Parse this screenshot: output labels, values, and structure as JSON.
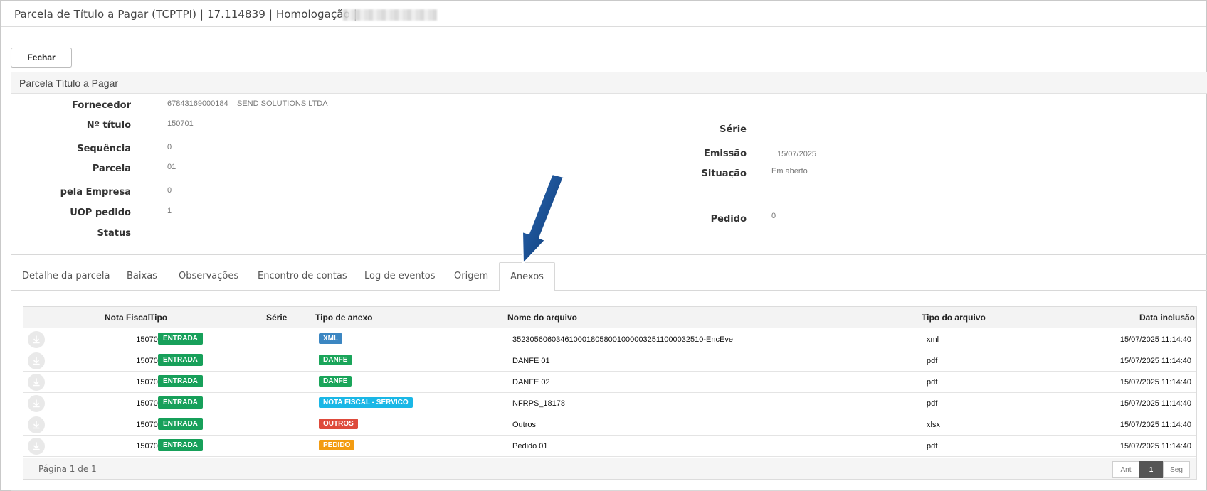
{
  "window": {
    "title": "Parcela de Título a Pagar (TCPTPI) | 17.114839 | Homologação |"
  },
  "toolbar": {
    "close_label": "Fechar"
  },
  "panel": {
    "title": "Parcela Título a Pagar",
    "fields": {
      "fornecedor_label": "Fornecedor",
      "fornecedor_code": "67843169000184",
      "fornecedor_name": "SEND SOLUTIONS LTDA",
      "titulo_label": "Nº título",
      "titulo_value": "150701",
      "sequencia_label": "Sequência",
      "sequencia_value": "0",
      "parcela_label": "Parcela",
      "parcela_value": "01",
      "empresa_label": "pela Empresa",
      "empresa_value": "0",
      "uop_label": "UOP pedido",
      "uop_value": "1",
      "status_label": "Status",
      "serie_label": "Série",
      "emissao_label": "Emissão",
      "emissao_value": "15/07/2025",
      "situacao_label": "Situação",
      "situacao_value": "Em aberto",
      "pedido_label": "Pedido",
      "pedido_value": "0"
    }
  },
  "tabs": [
    {
      "label": "Detalhe da parcela"
    },
    {
      "label": "Baixas"
    },
    {
      "label": "Observações"
    },
    {
      "label": "Encontro de contas"
    },
    {
      "label": "Log de eventos"
    },
    {
      "label": "Origem"
    },
    {
      "label": "Anexos",
      "active": true
    }
  ],
  "grid": {
    "columns": [
      "Nota Fiscal",
      "Tipo",
      "Série",
      "Tipo de anexo",
      "Nome do arquivo",
      "Tipo do arquivo",
      "Data inclusão"
    ],
    "rows": [
      {
        "nota": "150701",
        "tipo": "ENTRADA",
        "serie": "",
        "anexo": "XML",
        "anexo_color": "#3b86c2",
        "arquivo": "35230560603461000180580010000032511000032510-EncEve",
        "tipo_arquivo": "xml",
        "data": "15/07/2025 11:14:40"
      },
      {
        "nota": "150701",
        "tipo": "ENTRADA",
        "serie": "",
        "anexo": "DANFE",
        "anexo_color": "#1aa55a",
        "arquivo": "DANFE 01",
        "tipo_arquivo": "pdf",
        "data": "15/07/2025 11:14:40"
      },
      {
        "nota": "150701",
        "tipo": "ENTRADA",
        "serie": "",
        "anexo": "DANFE",
        "anexo_color": "#1aa55a",
        "arquivo": "DANFE 02",
        "tipo_arquivo": "pdf",
        "data": "15/07/2025 11:14:40"
      },
      {
        "nota": "150701",
        "tipo": "ENTRADA",
        "serie": "",
        "anexo": "NOTA FISCAL - SERVICO",
        "anexo_color": "#1ab7e6",
        "arquivo": "NFRPS_18178",
        "tipo_arquivo": "pdf",
        "data": "15/07/2025 11:14:40"
      },
      {
        "nota": "150701",
        "tipo": "ENTRADA",
        "serie": "",
        "anexo": "OUTROS",
        "anexo_color": "#de4a3b",
        "arquivo": "Outros",
        "tipo_arquivo": "xlsx",
        "data": "15/07/2025 11:14:40"
      },
      {
        "nota": "150701",
        "tipo": "ENTRADA",
        "serie": "",
        "anexo": "PEDIDO",
        "anexo_color": "#f39c12",
        "arquivo": "Pedido 01",
        "tipo_arquivo": "pdf",
        "data": "15/07/2025 11:14:40"
      }
    ],
    "entrada_color": "#17a05a",
    "pager": {
      "info": "Página 1 de 1",
      "prev": "Ant",
      "current": "1",
      "next": "Seg"
    }
  },
  "icons": {
    "download": "download-icon",
    "annotation_arrow": "arrow-icon"
  }
}
